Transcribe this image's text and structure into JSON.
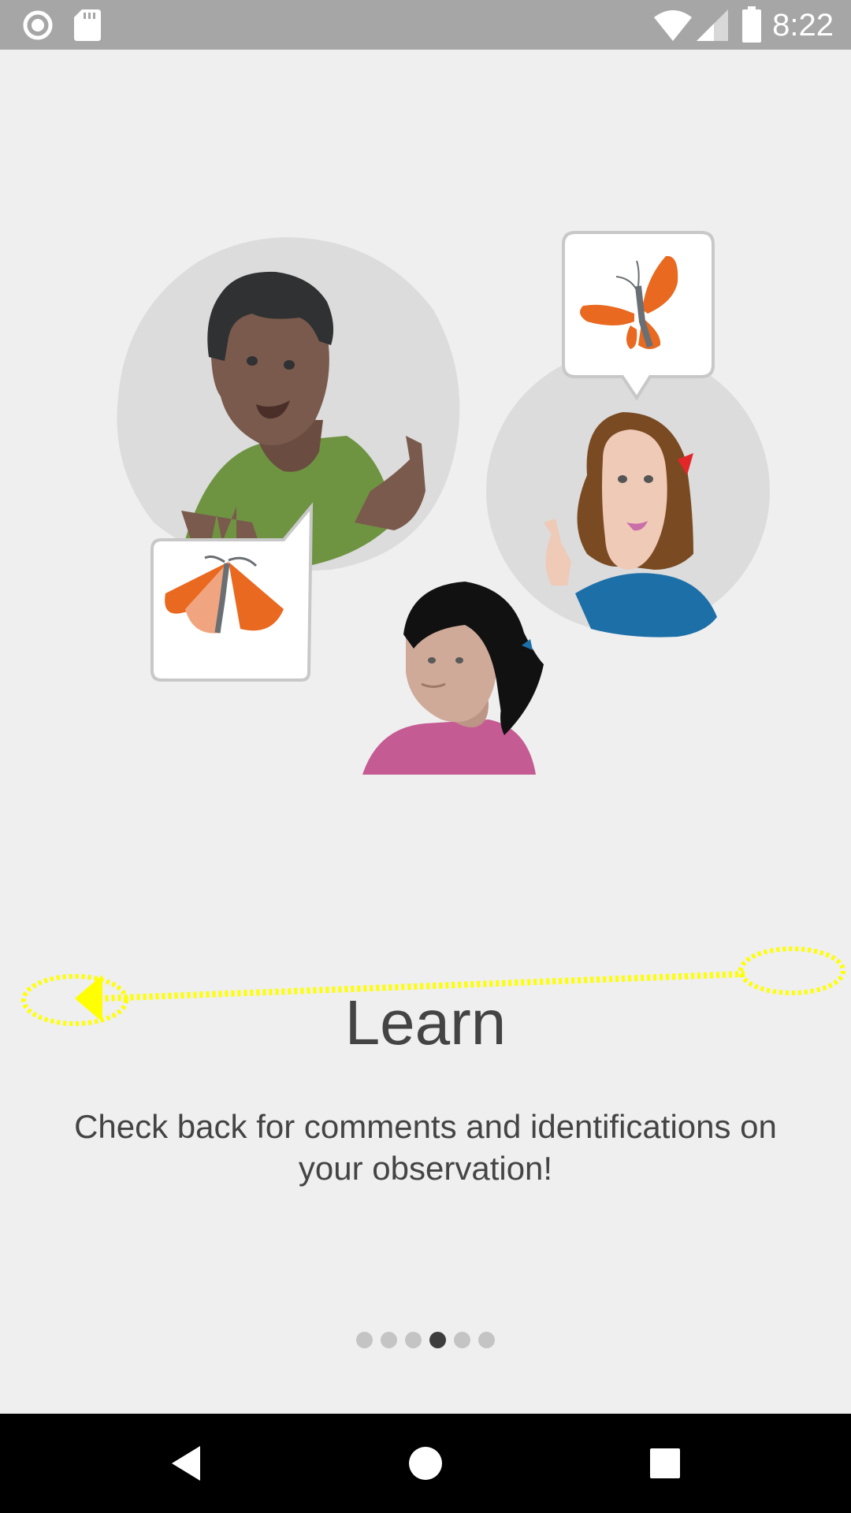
{
  "status_bar": {
    "time": "8:22",
    "left_icons": [
      "record-icon",
      "sd-card-icon"
    ],
    "right_icons": [
      "wifi-icon",
      "cell-signal-icon",
      "battery-icon"
    ]
  },
  "slide": {
    "title": "Learn",
    "description": "Check back for comments and identifications on your observation!",
    "illustration": "people-sharing-observations-illustration"
  },
  "pager": {
    "total": 6,
    "active_index": 3
  },
  "gesture_overlay": "swipe-left-gesture-icon",
  "nav_bar": {
    "buttons": [
      "back-icon",
      "home-icon",
      "recents-icon"
    ]
  },
  "colors": {
    "background": "#efefef",
    "status_bar": "#a6a6a6",
    "text": "#444444",
    "dot_inactive": "#c4c4c4",
    "dot_active": "#3d3d3d",
    "butterfly_orange": "#e8691f",
    "gesture_yellow": "#ffff00"
  }
}
